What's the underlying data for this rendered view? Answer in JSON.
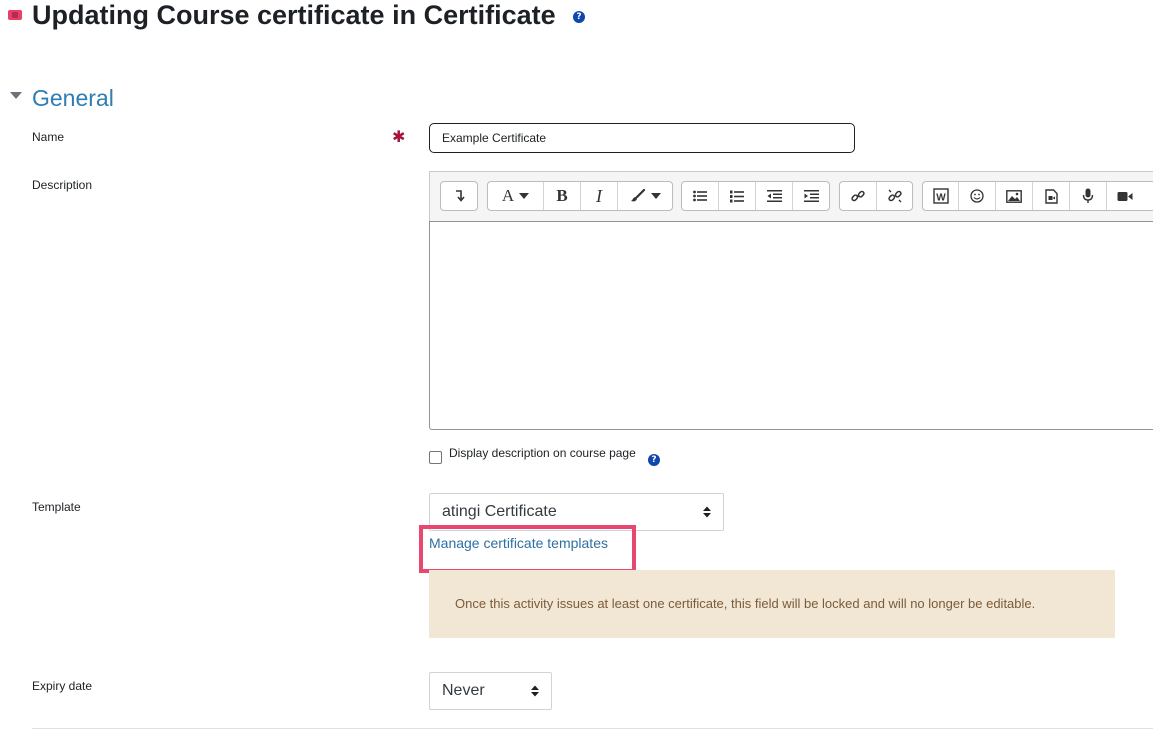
{
  "header": {
    "title": "Updating Course certificate in Certificate"
  },
  "section": {
    "title": "General"
  },
  "form": {
    "name_label": "Name",
    "name_value": "Example Certificate",
    "required_symbol": "✱",
    "description_label": "Description",
    "display_description_label": "Display description on course page",
    "template_label": "Template",
    "template_selected": "atingi Certificate",
    "manage_templates_link": "Manage certificate templates",
    "locked_notice": "Once this activity issues at least one certificate, this field will be locked and will no longer be editable.",
    "expiry_label": "Expiry date",
    "expiry_selected": "Never"
  },
  "editor_toolbar": {
    "groups": [
      [
        "collapse-icon"
      ],
      [
        "font-style-icon",
        "bold-icon",
        "italic-icon",
        "paint-brush-icon"
      ],
      [
        "unordered-list-icon",
        "ordered-list-icon",
        "outdent-icon",
        "indent-icon"
      ],
      [
        "link-icon",
        "unlink-icon"
      ],
      [
        "word-import-icon",
        "emoji-icon",
        "image-icon",
        "media-icon",
        "microphone-icon",
        "video-icon"
      ]
    ],
    "glyphs": {
      "bold": "B",
      "italic": "I",
      "font": "A"
    }
  },
  "colors": {
    "accent": "#2e7db3",
    "link": "#2e6fa3",
    "required": "#a3153a",
    "highlight": "#e8486f",
    "alert_bg": "#f2e6d5",
    "alert_text": "#7a5c3a",
    "module_icon": "#e83e6b"
  }
}
